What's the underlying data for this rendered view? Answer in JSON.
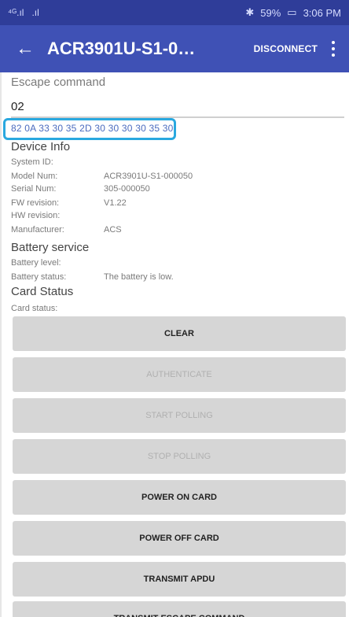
{
  "status_bar": {
    "left": [
      "⁴ᴳ.ıl",
      ".ıl"
    ],
    "right": "59%",
    "time": "3:06 PM"
  },
  "app_bar": {
    "title": "ACR3901U-S1-0…",
    "action": "DISCONNECT"
  },
  "escape": {
    "label": "Escape command",
    "value": "02",
    "response_hex": "82 0A 33 30 35 2D 30 30 30 30 35 30"
  },
  "device_info": {
    "header": "Device Info",
    "rows": [
      {
        "label": "System ID:",
        "value": ""
      },
      {
        "label": "Model Num:",
        "value": "ACR3901U-S1-000050"
      },
      {
        "label": "Serial Num:",
        "value": "305-000050"
      },
      {
        "label": "FW revision:",
        "value": "V1.22"
      },
      {
        "label": "HW revision:",
        "value": ""
      },
      {
        "label": "Manufacturer:",
        "value": "ACS"
      }
    ]
  },
  "battery": {
    "header": "Battery service",
    "rows": [
      {
        "label": "Battery level:",
        "value": ""
      },
      {
        "label": "Battery status:",
        "value": "The battery is low."
      }
    ]
  },
  "card": {
    "header": "Card Status",
    "rows": [
      {
        "label": "Card status:",
        "value": ""
      }
    ]
  },
  "buttons": [
    {
      "label": "CLEAR",
      "enabled": true
    },
    {
      "label": "AUTHENTICATE",
      "enabled": false
    },
    {
      "label": "START POLLING",
      "enabled": false
    },
    {
      "label": "STOP POLLING",
      "enabled": false
    },
    {
      "label": "POWER ON CARD",
      "enabled": true
    },
    {
      "label": "POWER OFF CARD",
      "enabled": true
    },
    {
      "label": "TRANSMIT APDU",
      "enabled": true
    },
    {
      "label": "TRANSMIT ESCAPE COMMAND",
      "enabled": true
    }
  ]
}
